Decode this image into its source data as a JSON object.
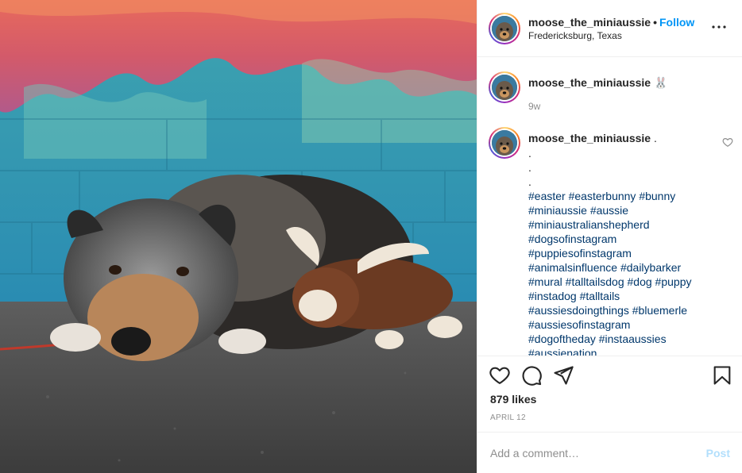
{
  "post": {
    "photo_alt": "",
    "colors": {
      "accent": "#0095f6",
      "link": "#00376b",
      "muted": "#8e8e8e",
      "post_disabled": "#b2dffc"
    }
  },
  "header": {
    "username": "moose_the_miniaussie",
    "separator": "•",
    "follow_label": "Follow",
    "location": "Fredericksburg, Texas",
    "more_icon": "more-horizontal-icon"
  },
  "comments": {
    "first": {
      "username": "moose_the_miniaussie",
      "emoji": "🐰",
      "time": "9w"
    },
    "caption": {
      "username": "moose_the_miniaussie",
      "first_text": ".",
      "dots": [
        ".",
        ".",
        "."
      ],
      "hashtag_lines": [
        "#easter #easterbunny #bunny",
        "#miniaussie #aussie",
        "#miniaustralianshepherd",
        "#dogsofinstagram",
        "#puppiesofinstagram",
        "#animalsinfluence #dailybarker",
        "#mural #talltailsdog #dog #puppy",
        "#instadog #talltails",
        "#aussiesdoingthings #bluemerle",
        "#aussiesofinstagram",
        "#dogoftheday #instaaussies",
        "#aussienation"
      ]
    }
  },
  "actions": {
    "like_icon": "heart-icon",
    "comment_icon": "comment-icon",
    "share_icon": "share-icon",
    "save_icon": "bookmark-icon",
    "likes": "879 likes",
    "date": "APRIL 12"
  },
  "comment_bar": {
    "placeholder": "Add a comment…",
    "post_label": "Post"
  }
}
